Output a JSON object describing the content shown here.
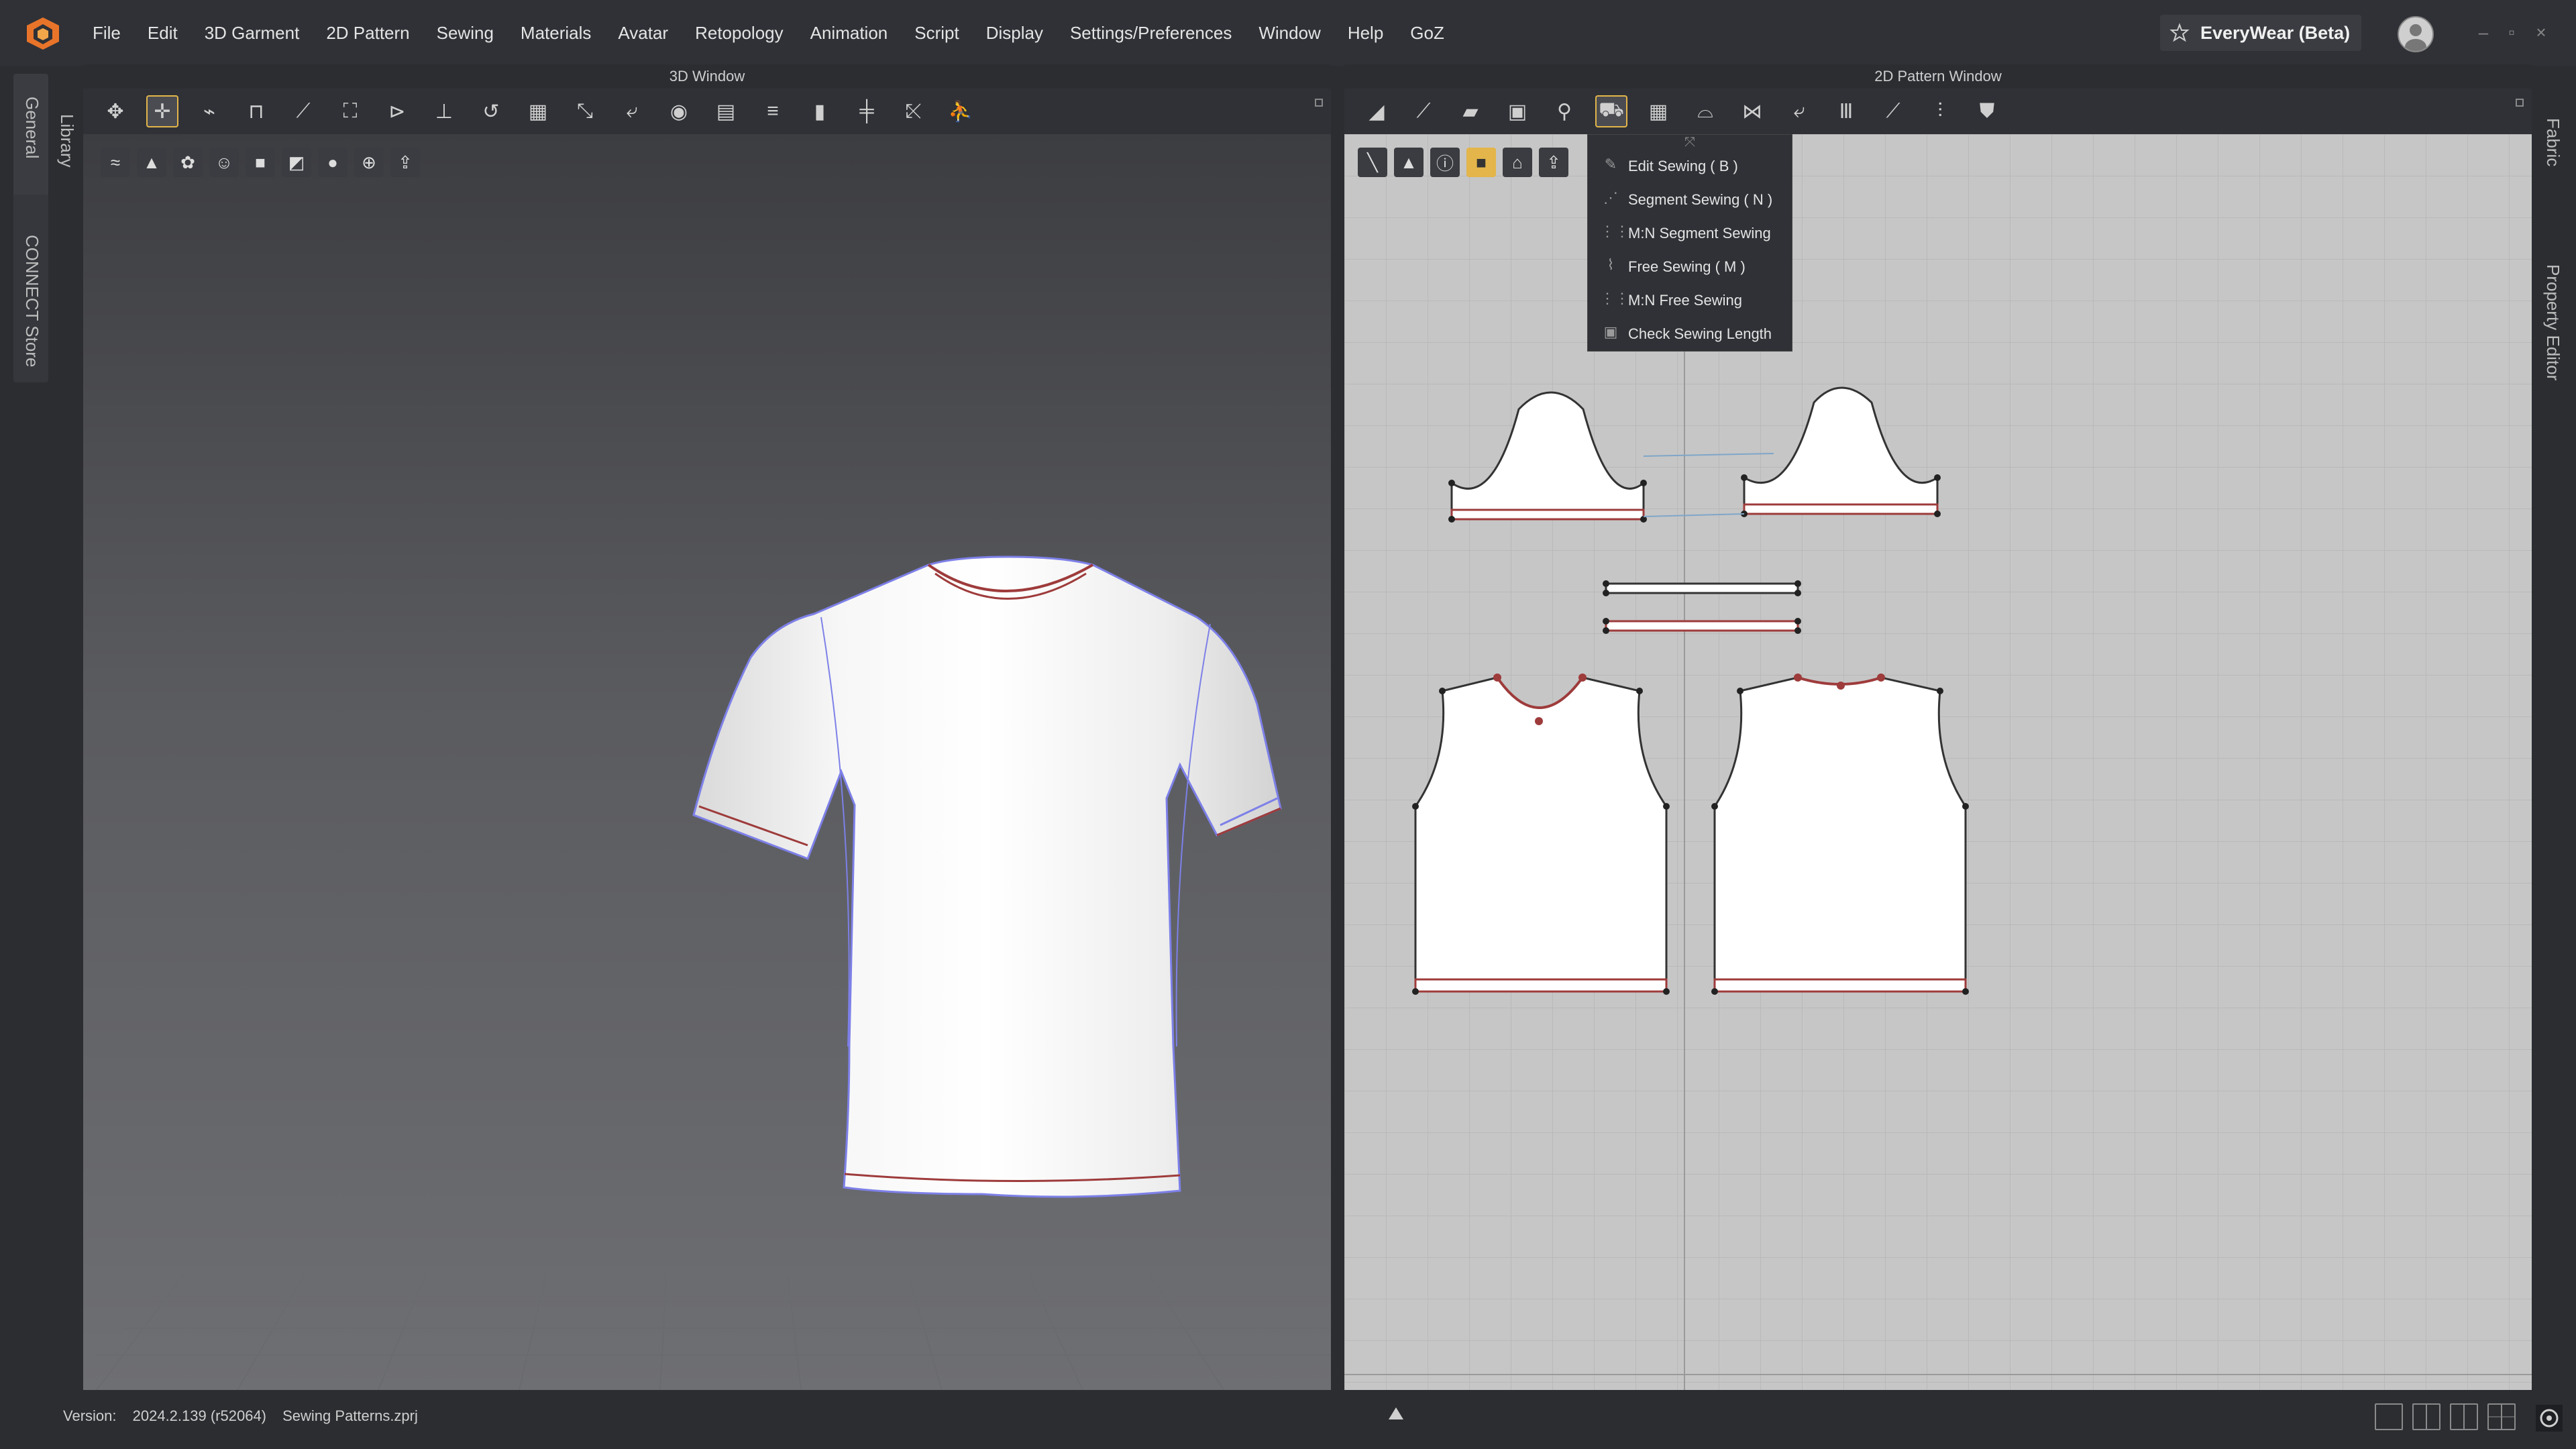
{
  "menubar": {
    "items": [
      "File",
      "Edit",
      "3D Garment",
      "2D Pattern",
      "Sewing",
      "Materials",
      "Avatar",
      "Retopology",
      "Animation",
      "Script",
      "Display",
      "Settings/Preferences",
      "Window",
      "Help",
      "GoZ"
    ],
    "workspace": "EveryWear (Beta)"
  },
  "sidebar_left": {
    "tabs": [
      "Library",
      "General",
      "CONNECT Store"
    ]
  },
  "sidebar_right": {
    "tabs": [
      "Fabric",
      "Property Editor"
    ]
  },
  "window3d": {
    "title": "3D Window"
  },
  "window2d": {
    "title": "2D Pattern Window"
  },
  "sewing_menu": {
    "items": [
      {
        "label": "Edit Sewing ( B )",
        "icon": "edit-sewing-icon"
      },
      {
        "label": "Segment Sewing ( N )",
        "icon": "segment-sewing-icon"
      },
      {
        "label": "M:N Segment Sewing",
        "icon": "mn-segment-sewing-icon"
      },
      {
        "label": "Free Sewing ( M )",
        "icon": "free-sewing-icon"
      },
      {
        "label": "M:N Free Sewing",
        "icon": "mn-free-sewing-icon"
      },
      {
        "label": "Check Sewing Length",
        "icon": "check-sewing-length-icon"
      }
    ]
  },
  "status": {
    "version_label": "Version:",
    "version": "2024.2.139 (r52064)",
    "file": "Sewing Patterns.zprj"
  },
  "colors": {
    "accent": "#e3b54a",
    "seam": "#9e3b3b",
    "outline": "#6f78e0"
  }
}
